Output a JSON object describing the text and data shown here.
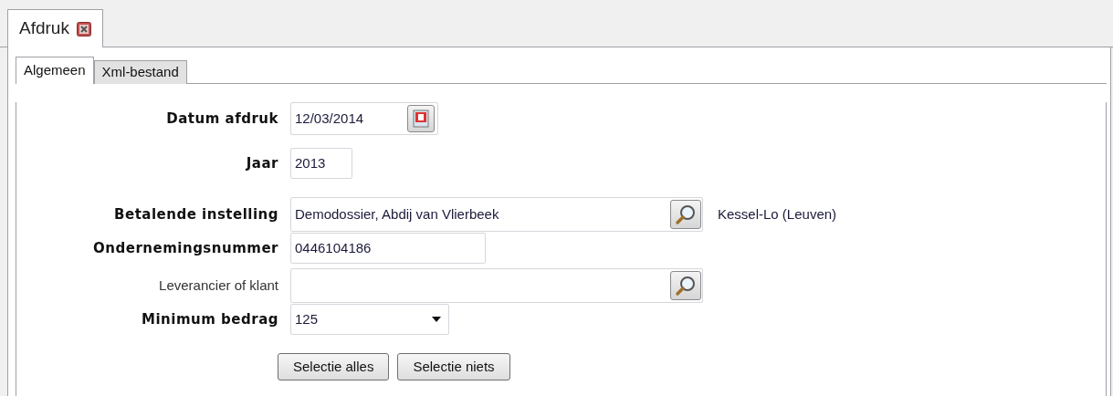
{
  "document_tabs": [
    {
      "label": "Afdruk",
      "selected": true
    }
  ],
  "tabs": [
    {
      "label": "Algemeen",
      "selected": true
    },
    {
      "label": "Xml-bestand",
      "selected": false
    }
  ],
  "fields": [
    {
      "kind": "date",
      "label": "Datum afdruk",
      "bold": true,
      "value": "12/03/2014"
    },
    {
      "kind": "short",
      "label": "Jaar",
      "bold": true,
      "value": "2013"
    },
    {
      "kind": "lookup",
      "label": "Betalende instelling",
      "bold": true,
      "value": "Demodossier, Abdij van Vlierbeek",
      "extra": "Kessel-Lo (Leuven)"
    },
    {
      "kind": "text",
      "label": "Ondernemingsnummer",
      "bold": true,
      "value": "0446104186"
    },
    {
      "kind": "lookup",
      "label": "Leverancier of klant",
      "bold": false
    },
    {
      "kind": "dropdown",
      "label": "Minimum bedrag",
      "bold": true,
      "value": "125"
    }
  ],
  "buttons": [
    "Selectie alles",
    "Selectie niets"
  ]
}
